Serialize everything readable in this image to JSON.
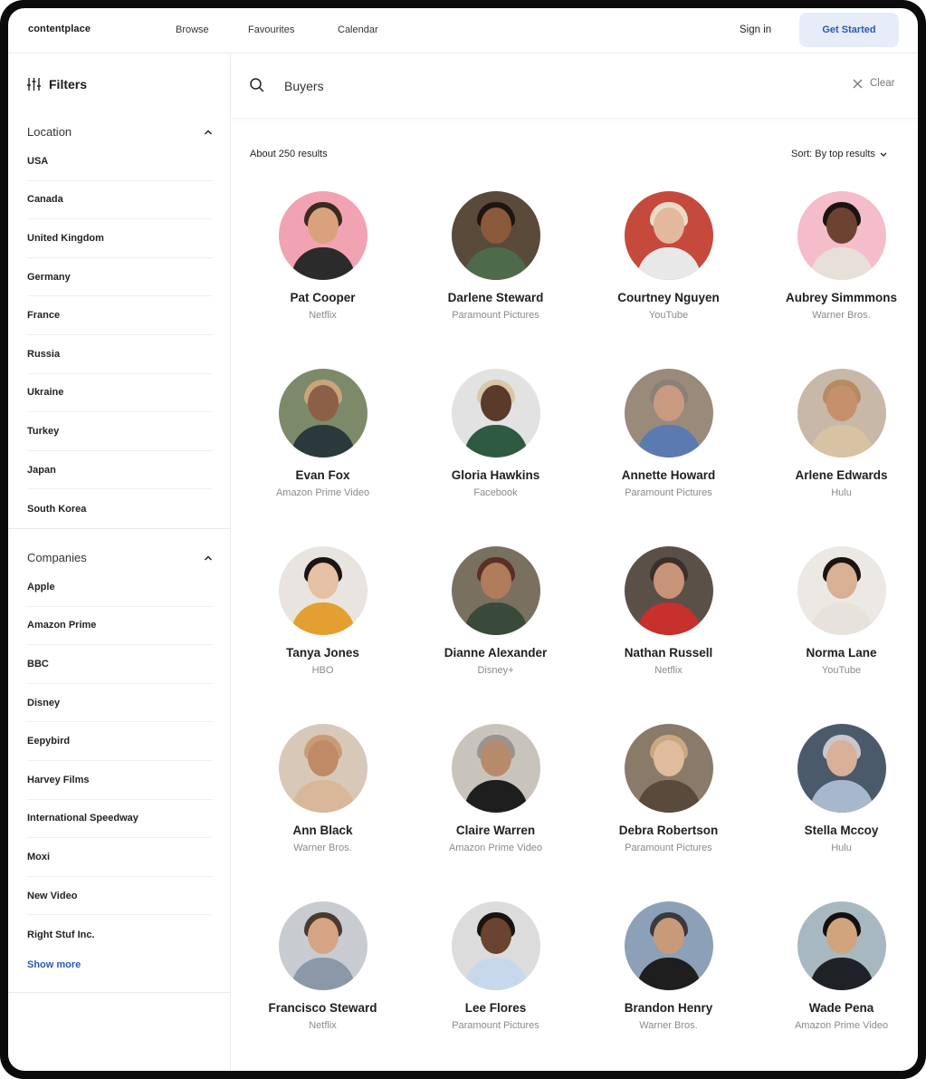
{
  "brand": "contentplace",
  "nav": {
    "browse": "Browse",
    "favourites": "Favourites",
    "calendar": "Calendar",
    "sign_in": "Sign in",
    "get_started": "Get Started"
  },
  "filters": {
    "title": "Filters",
    "location": {
      "title": "Location",
      "items": [
        "USA",
        "Canada",
        "United Kingdom",
        "Germany",
        "France",
        "Russia",
        "Ukraine",
        "Turkey",
        "Japan",
        "South Korea"
      ]
    },
    "companies": {
      "title": "Companies",
      "items": [
        "Apple",
        "Amazon Prime",
        "BBC",
        "Disney",
        "Eepybird",
        "Harvey Films",
        "International Speedway",
        "Moxi",
        "New Video",
        "Right Stuf Inc."
      ],
      "show_more": "Show more"
    }
  },
  "search": {
    "value": "Buyers",
    "clear_label": "Clear"
  },
  "results": {
    "count_text": "About 250 results",
    "sort_label": "Sort: By top results"
  },
  "people": [
    {
      "name": "Pat Cooper",
      "company": "Netflix",
      "bg": "#f2a3b3",
      "skin": "#d9a27c",
      "hair": "#3a2a20",
      "shirt": "#2b2b2b"
    },
    {
      "name": "Darlene Steward",
      "company": "Paramount Pictures",
      "bg": "#5a4a3a",
      "skin": "#8a5a3c",
      "hair": "#1e1410",
      "shirt": "#4d6b4a"
    },
    {
      "name": "Courtney Nguyen",
      "company": "YouTube",
      "bg": "#c54a3c",
      "skin": "#e4b89c",
      "hair": "#e8dcc8",
      "shirt": "#e8e8e8"
    },
    {
      "name": "Aubrey Simmmons",
      "company": "Warner Bros.",
      "bg": "#f4bdc9",
      "skin": "#6b4330",
      "hair": "#1a1410",
      "shirt": "#e6e0d8"
    },
    {
      "name": "Evan Fox",
      "company": "Amazon Prime Video",
      "bg": "#7c8a6a",
      "skin": "#8c6046",
      "hair": "#c9a57a",
      "shirt": "#2a3a3c"
    },
    {
      "name": "Gloria Hawkins",
      "company": "Facebook",
      "bg": "#e2e2e2",
      "skin": "#5a3a28",
      "hair": "#d9c8a8",
      "shirt": "#2e5a42"
    },
    {
      "name": "Annette Howard",
      "company": "Paramount Pictures",
      "bg": "#9a8a7a",
      "skin": "#c99a80",
      "hair": "#8a8078",
      "shirt": "#5a7ab0"
    },
    {
      "name": "Arlene Edwards",
      "company": "Hulu",
      "bg": "#c8b8a8",
      "skin": "#c6906c",
      "hair": "#b88a62",
      "shirt": "#d8c2a4"
    },
    {
      "name": "Tanya Jones",
      "company": "HBO",
      "bg": "#e8e4e0",
      "skin": "#e6c0a4",
      "hair": "#1c1612",
      "shirt": "#e3a030"
    },
    {
      "name": "Dianne Alexander",
      "company": "Disney+",
      "bg": "#7a7060",
      "skin": "#b07c5c",
      "hair": "#5a3020",
      "shirt": "#3a4a3a"
    },
    {
      "name": "Nathan Russell",
      "company": "Netflix",
      "bg": "#5a5048",
      "skin": "#c89478",
      "hair": "#3c3028",
      "shirt": "#c8302c"
    },
    {
      "name": "Norma Lane",
      "company": "YouTube",
      "bg": "#ece8e4",
      "skin": "#d8b094",
      "hair": "#1a1410",
      "shirt": "#e8e2dc"
    },
    {
      "name": "Ann Black",
      "company": "Warner Bros.",
      "bg": "#d8c8b8",
      "skin": "#c08a66",
      "hair": "#c89c74",
      "shirt": "#d8b898"
    },
    {
      "name": "Claire Warren",
      "company": "Amazon Prime Video",
      "bg": "#c8c4bc",
      "skin": "#b88a6c",
      "hair": "#9a9490",
      "shirt": "#1e1e1e"
    },
    {
      "name": "Debra Robertson",
      "company": "Paramount Pictures",
      "bg": "#8a7a6a",
      "skin": "#e0bc9c",
      "hair": "#c8a880",
      "shirt": "#5a4a3c"
    },
    {
      "name": "Stella Mccoy",
      "company": "Hulu",
      "bg": "#4a5a6a",
      "skin": "#d8b098",
      "hair": "#c8c8cc",
      "shirt": "#a8b8cc"
    },
    {
      "name": "Francisco Steward",
      "company": "Netflix",
      "bg": "#c8ccd0",
      "skin": "#d4a484",
      "hair": "#4a3a2c",
      "shirt": "#8a98a8"
    },
    {
      "name": "Lee Flores",
      "company": "Paramount Pictures",
      "bg": "#dcdcdc",
      "skin": "#6a4430",
      "hair": "#1a1410",
      "shirt": "#c8d8ec"
    },
    {
      "name": "Brandon Henry",
      "company": "Warner Bros.",
      "bg": "#8ca0b8",
      "skin": "#c89a7a",
      "hair": "#3a3a3a",
      "shirt": "#1e1e1e"
    },
    {
      "name": "Wade Pena",
      "company": "Amazon Prime Video",
      "bg": "#a8b8c0",
      "skin": "#d0a47c",
      "hair": "#141010",
      "shirt": "#1e2226"
    }
  ]
}
